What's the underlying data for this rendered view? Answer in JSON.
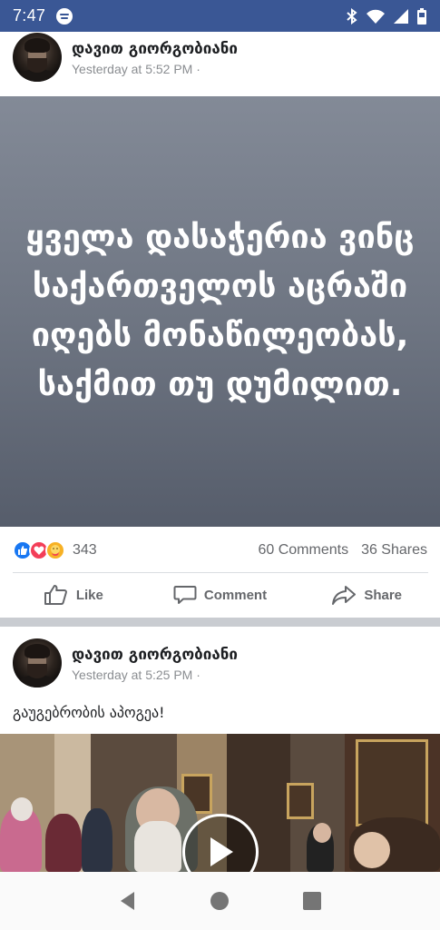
{
  "status_bar": {
    "time": "7:47",
    "icons": [
      "spotify-icon",
      "bluetooth-icon",
      "wifi-icon",
      "signal-icon",
      "battery-icon"
    ]
  },
  "post1": {
    "author": "დავით გიორგობიანი",
    "time": "Yesterday at 5:52 PM ·",
    "text": "ყველა დასაჭერია ვინც საქართველოს აცრაში იღებს მონაწილეობას,საქმით თუ დუმილით.",
    "reactions_count": "343",
    "comments": "60 Comments",
    "shares": "36 Shares",
    "reaction_icons": [
      "like-icon",
      "love-icon",
      "care-icon"
    ]
  },
  "actions": {
    "like": "Like",
    "comment": "Comment",
    "share": "Share"
  },
  "post2": {
    "author": "დავით გიორგობიანი",
    "time": "Yesterday at 5:25 PM ·",
    "caption": "გაუგებრობის აპოგეა!"
  },
  "colors": {
    "facebook_blue": "#3a5795",
    "text_post_bg": "#6f7683",
    "like_blue": "#1877f2",
    "love_red": "#f33e58",
    "care_yellow": "#f7b125"
  }
}
